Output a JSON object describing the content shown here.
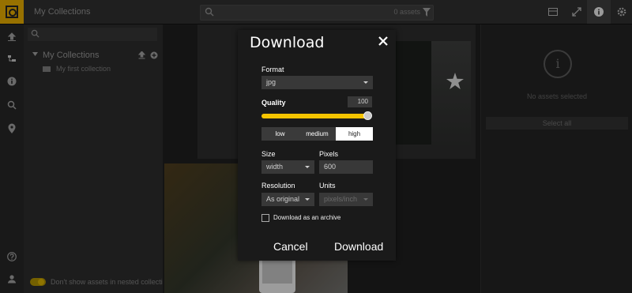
{
  "header": {
    "title": "My Collections",
    "search_placeholder": "",
    "search_scope": "0 assets"
  },
  "sidebar": {
    "search_placeholder": "",
    "tree": {
      "root_label": "My Collections",
      "children": [
        {
          "label": "My first collection"
        }
      ]
    },
    "toggle_label": "Don't show assets in nested collections"
  },
  "right_panel": {
    "message": "No assets selected",
    "select_all": "Select all"
  },
  "modal": {
    "title": "Download",
    "format": {
      "label": "Format",
      "value": "jpg"
    },
    "quality": {
      "label": "Quality",
      "value": "100",
      "fraction": 1.0
    },
    "quality_presets": [
      {
        "label": "low",
        "active": false
      },
      {
        "label": "medium",
        "active": false
      },
      {
        "label": "high",
        "active": true
      }
    ],
    "size": {
      "label": "Size",
      "value": "width"
    },
    "pixels": {
      "label": "Pixels",
      "value": "600"
    },
    "resolution": {
      "label": "Resolution",
      "value": "As original"
    },
    "units": {
      "label": "Units",
      "value": "pixels/inch"
    },
    "archive_label": "Download as an archive",
    "archive_checked": false,
    "cancel_label": "Cancel",
    "download_label": "Download"
  },
  "colors": {
    "accent": "#f5c400",
    "logo_bg": "#d8a200",
    "modal_bg": "#1a1a1a"
  }
}
